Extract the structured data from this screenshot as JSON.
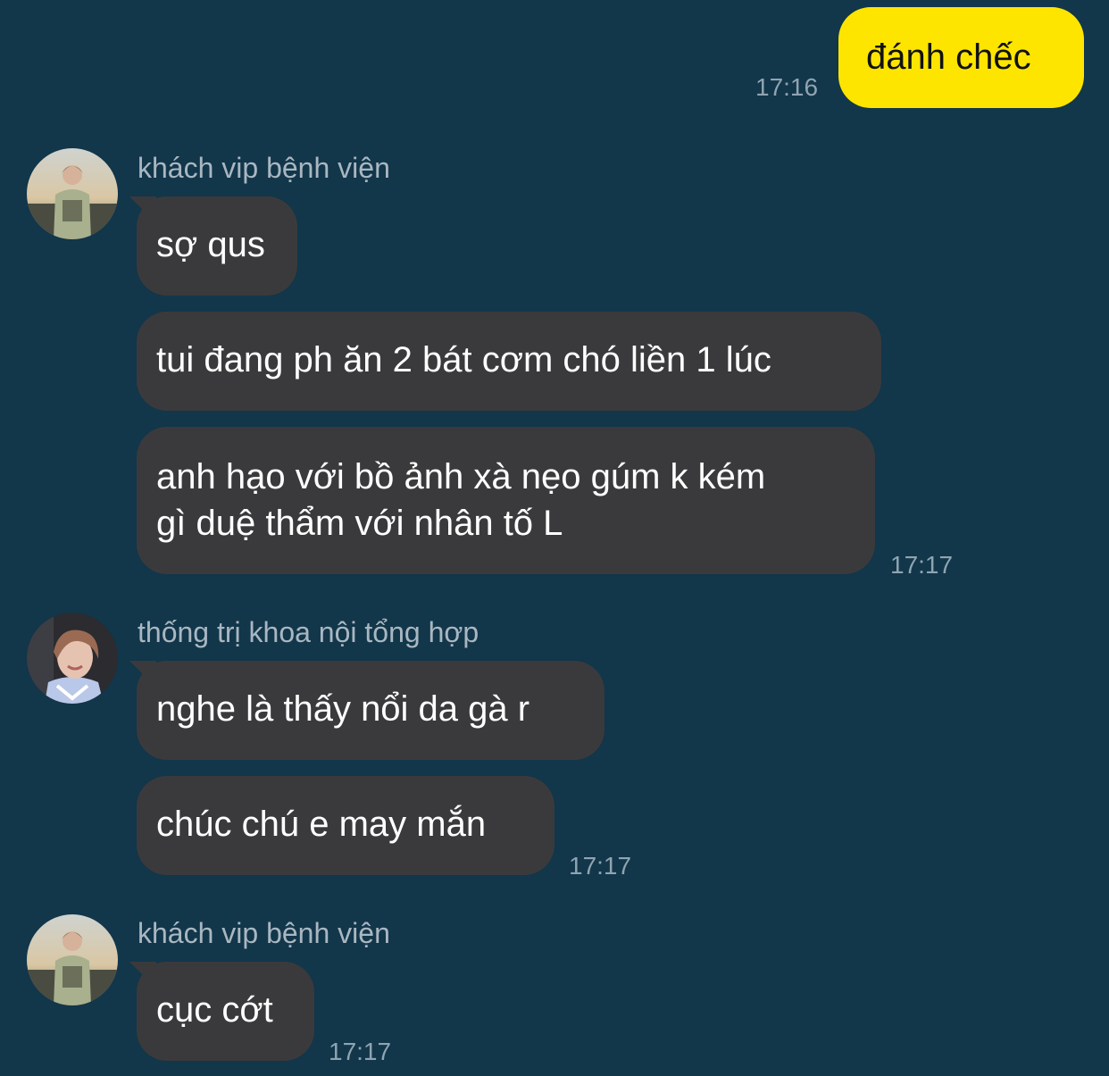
{
  "outgoing": [
    {
      "text": "đánh chếc",
      "time": "17:16"
    }
  ],
  "groups": [
    {
      "sender": "khách vip bệnh viện",
      "avatar": "hoodie-guy-avatar",
      "messages": [
        {
          "text": "sợ qus"
        },
        {
          "text": "tui đang ph ăn 2 bát cơm chó liền 1 lúc"
        },
        {
          "line1": "anh hạo với bồ ảnh xà nẹo gúm k kém",
          "line2": "gì duệ thẩm với nhân tố L"
        }
      ],
      "time": "17:17"
    },
    {
      "sender": "thống trị khoa nội tổng hợp",
      "avatar": "smiling-guy-avatar",
      "messages": [
        {
          "text": "nghe là thấy nổi da gà r"
        },
        {
          "text": "chúc chú e may mắn"
        }
      ],
      "time": "17:17"
    },
    {
      "sender": "khách vip bệnh viện",
      "avatar": "hoodie-guy-avatar",
      "messages": [
        {
          "text": "cục cớt"
        }
      ],
      "time": "17:17"
    }
  ],
  "colors": {
    "background": "#12364a",
    "incoming_bubble": "#3a3a3c",
    "outgoing_bubble": "#fee500"
  }
}
